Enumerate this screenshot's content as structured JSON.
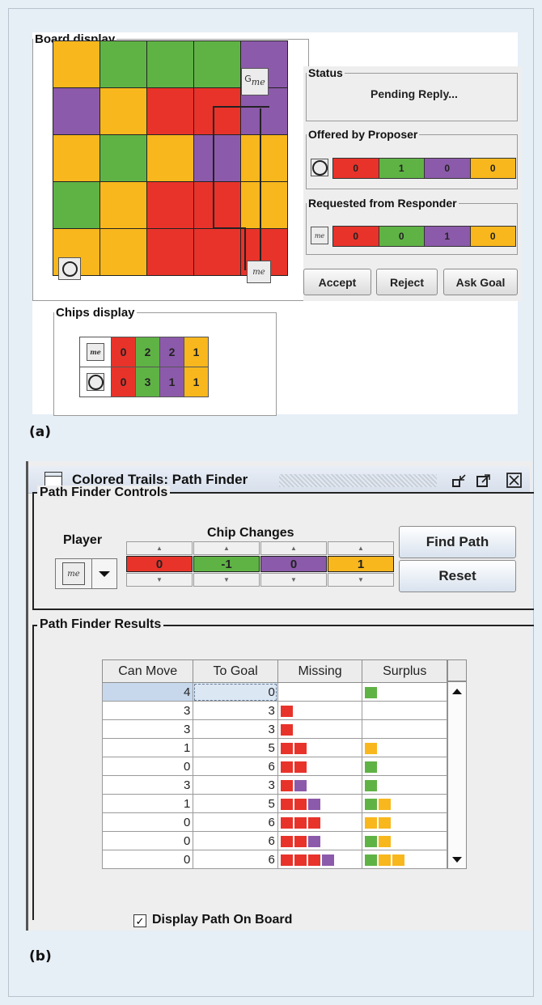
{
  "panel_a": {
    "caption": "(a)",
    "board": {
      "title": "Board display",
      "grid": [
        [
          "orange",
          "green",
          "green",
          "green",
          "purple"
        ],
        [
          "purple",
          "orange",
          "red",
          "red",
          "purple"
        ],
        [
          "orange",
          "green",
          "orange",
          "purple",
          "orange"
        ],
        [
          "green",
          "orange",
          "red",
          "red",
          "orange"
        ],
        [
          "orange",
          "orange",
          "red",
          "red",
          "red"
        ]
      ],
      "goal_label": "G",
      "me_label": "me"
    },
    "status": {
      "title": "Status",
      "text": "Pending Reply..."
    },
    "offered": {
      "title": "Offered by Proposer",
      "chips": [
        "0",
        "1",
        "0",
        "0"
      ]
    },
    "requested": {
      "title": "Requested from Responder",
      "chips": [
        "0",
        "0",
        "1",
        "0"
      ],
      "me_label": "me"
    },
    "buttons": {
      "accept": "Accept",
      "reject": "Reject",
      "ask_goal": "Ask Goal"
    },
    "chips_display": {
      "title": "Chips display",
      "me_label": "me",
      "me_chips": [
        "0",
        "2",
        "2",
        "1"
      ],
      "other_chips": [
        "0",
        "3",
        "1",
        "1"
      ]
    }
  },
  "panel_b": {
    "caption": "(b)",
    "window_title": "Colored Trails: Path Finder",
    "controls": {
      "title": "Path Finder Controls",
      "player_label": "Player",
      "player_value": "me",
      "chip_changes_label": "Chip Changes",
      "chip_changes": [
        "0",
        "-1",
        "0",
        "1"
      ],
      "find_path": "Find Path",
      "reset": "Reset"
    },
    "results": {
      "title": "Path Finder Results",
      "columns": [
        "Can Move",
        "To Goal",
        "Missing",
        "Surplus"
      ],
      "rows": [
        {
          "can_move": "4",
          "to_goal": "0",
          "missing": [],
          "surplus": [
            "green"
          ]
        },
        {
          "can_move": "3",
          "to_goal": "3",
          "missing": [
            "red"
          ],
          "surplus": []
        },
        {
          "can_move": "3",
          "to_goal": "3",
          "missing": [
            "red"
          ],
          "surplus": []
        },
        {
          "can_move": "1",
          "to_goal": "5",
          "missing": [
            "red",
            "red"
          ],
          "surplus": [
            "orange"
          ]
        },
        {
          "can_move": "0",
          "to_goal": "6",
          "missing": [
            "red",
            "red"
          ],
          "surplus": [
            "green"
          ]
        },
        {
          "can_move": "3",
          "to_goal": "3",
          "missing": [
            "red",
            "purple"
          ],
          "surplus": [
            "green"
          ]
        },
        {
          "can_move": "1",
          "to_goal": "5",
          "missing": [
            "red",
            "red",
            "purple"
          ],
          "surplus": [
            "green",
            "orange"
          ]
        },
        {
          "can_move": "0",
          "to_goal": "6",
          "missing": [
            "red",
            "red",
            "red"
          ],
          "surplus": [
            "orange",
            "orange"
          ]
        },
        {
          "can_move": "0",
          "to_goal": "6",
          "missing": [
            "red",
            "red",
            "purple"
          ],
          "surplus": [
            "green",
            "orange"
          ]
        },
        {
          "can_move": "0",
          "to_goal": "6",
          "missing": [
            "red",
            "red",
            "red",
            "purple"
          ],
          "surplus": [
            "green",
            "orange",
            "orange"
          ]
        }
      ],
      "display_path_label": "Display Path On Board",
      "display_path_checked": true
    }
  },
  "colors": {
    "red": "#e8332a",
    "green": "#5fb345",
    "purple": "#8c5aaa",
    "orange": "#f8b71d",
    "background": "#e6eef6"
  }
}
